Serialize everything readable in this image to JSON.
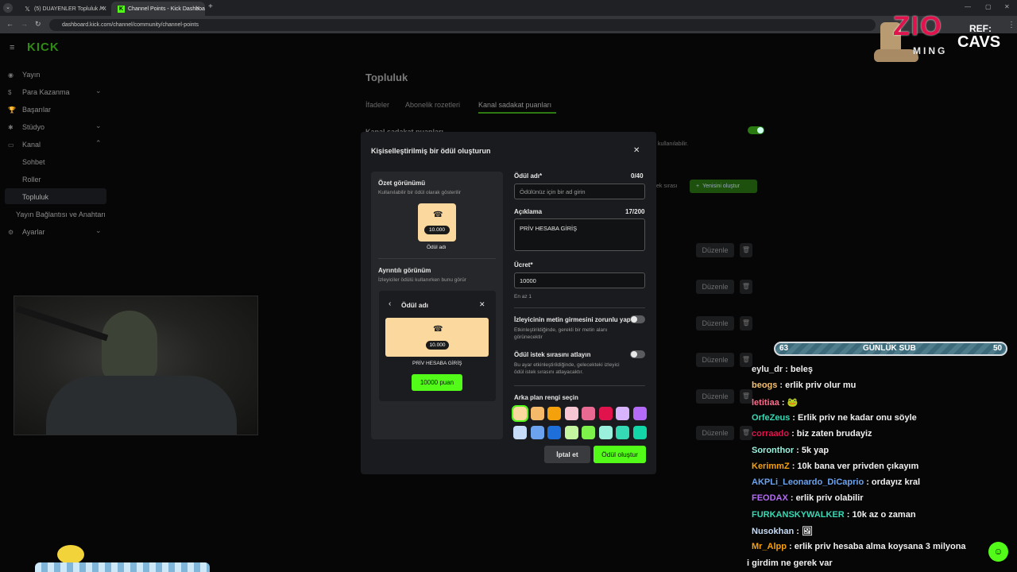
{
  "browser": {
    "tabs": [
      {
        "label": "(5) DUAYENLER Topluluk / X",
        "icon": "x-logo-icon"
      },
      {
        "label": "Channel Points - Kick Dashboa",
        "icon": "kick-logo-icon"
      }
    ],
    "url": "dashboard.kick.com/channel/community/channel-points"
  },
  "sidebar": {
    "logo": "KICK",
    "items": [
      {
        "label": "Yayın",
        "icon": "broadcast-icon"
      },
      {
        "label": "Para Kazanma",
        "icon": "money-icon"
      },
      {
        "label": "Başarılar",
        "icon": "trophy-icon"
      },
      {
        "label": "Stüdyo",
        "icon": "studio-icon"
      },
      {
        "label": "Kanal",
        "icon": "channel-icon"
      },
      {
        "label": "Sohbet"
      },
      {
        "label": "Roller"
      },
      {
        "label": "Topluluk"
      },
      {
        "label": "Yayın Bağlantısı ve Anahtarı"
      },
      {
        "label": "Ayarlar",
        "icon": "gear-icon"
      }
    ]
  },
  "page": {
    "title": "Topluluk",
    "tabs": [
      "İfadeler",
      "Abonelik rozetleri",
      "Kanal sadakat puanları"
    ],
    "partial_text_1": "Kanal sadakat puanları",
    "partial_text_2": "kullanılabilir.",
    "partial_text_3": "ek sırası",
    "create_new_label": "Yenisini oluştur",
    "edit_label": "Düzenle"
  },
  "modal": {
    "title": "Kişiselleştirilmiş bir ödül oluşturun",
    "summary_title": "Özet görünümü",
    "summary_sub": "Kullanılabilir bir ödül olarak gösterilir",
    "cost_value": "10.000",
    "reward_name_default": "Ödül adı",
    "detail_title": "Ayrıntılı görünüm",
    "detail_sub": "İzleyiciler ödülü kullanırken bunu görür",
    "detail_header": "Ödül adı",
    "detail_desc": "PRİV HESABA GİRİŞ",
    "detail_button": "10000 puan",
    "name_label": "Ödül adı*",
    "name_count": "0/40",
    "name_placeholder": "Ödülünüz için bir ad girin",
    "desc_label": "Açıklama",
    "desc_count": "17/200",
    "desc_value": "PRİV HESABA GİRİŞ",
    "price_label": "Ücret*",
    "price_value": "10000",
    "price_hint": "En az 1",
    "opt1_title": "İzleyicinin metin girmesini zorunlu yap",
    "opt1_desc": "Etkinleştirildiğinde, gerekli bir metin alanı görünecektir",
    "opt2_title": "Ödül istek sırasını atlayın",
    "opt2_desc": "Bu ayar etkinleştirildiğinde, gelecekteki izleyici ödül istek sırasını atlayacaktır.",
    "color_label": "Arka plan rengi seçin",
    "colors": [
      "#fbd89d",
      "#f5b96a",
      "#f5a10b",
      "#f7c6d3",
      "#e86a92",
      "#e0134d",
      "#d8b4fe",
      "#b46bf7",
      "#c6dcf7",
      "#6ba3ef",
      "#1e6fd9",
      "#c4f7a0",
      "#7cf24a",
      "#9af0dc",
      "#35d9b3",
      "#13d6a8"
    ],
    "cancel_label": "İptal et",
    "create_label": "Ödül oluştur"
  },
  "overlay": {
    "brand": "ZIO",
    "brand_sub": "MING",
    "ref": "REF:",
    "ref_name": "CAVS",
    "sub_goal_left": "63",
    "sub_goal_label": "GÜNLÜK SUB",
    "sub_goal_right": "50"
  },
  "chat": [
    {
      "user": "eylu_dr",
      "color": "#e8e8e8",
      "msg": ": beleş"
    },
    {
      "user": "beogs",
      "color": "#f5c06e",
      "msg": ": erlik priv olur mu"
    },
    {
      "user": "letitiaa",
      "color": "#ff6b8a",
      "msg": ": 🐸"
    },
    {
      "user": "OrfeZeus",
      "color": "#35d9b3",
      "msg": ": Erlik priv ne kadar onu söyle"
    },
    {
      "user": "corraado",
      "color": "#e0134d",
      "msg": ": biz zaten brudayiz"
    },
    {
      "user": "Soronthor",
      "color": "#9af0dc",
      "msg": ": 5k yap"
    },
    {
      "user": "KerimmZ",
      "color": "#f5a10b",
      "msg": ": 10k bana ver privden çıkayım"
    },
    {
      "user": "AKPLi_Leonardo_DiCaprio",
      "color": "#6ba3ef",
      "msg": ": ordayız kral"
    },
    {
      "user": "FEODAX",
      "color": "#b46bf7",
      "msg": ": erlik priv olabilir"
    },
    {
      "user": "FURKANSKYWALKER",
      "color": "#35d9b3",
      "msg": ": 10k az o zaman"
    },
    {
      "user": "Nusokhan",
      "color": "#c6dcf7",
      "msg": ": 🖼"
    },
    {
      "user": "Mr_Alpp",
      "color": "#f5a10b",
      "msg": ": erlik priv hesaba alma koysana 3 milyona"
    },
    {
      "user": "",
      "color": "#e8e8e8",
      "msg": "i girdim ne gerek var"
    }
  ]
}
